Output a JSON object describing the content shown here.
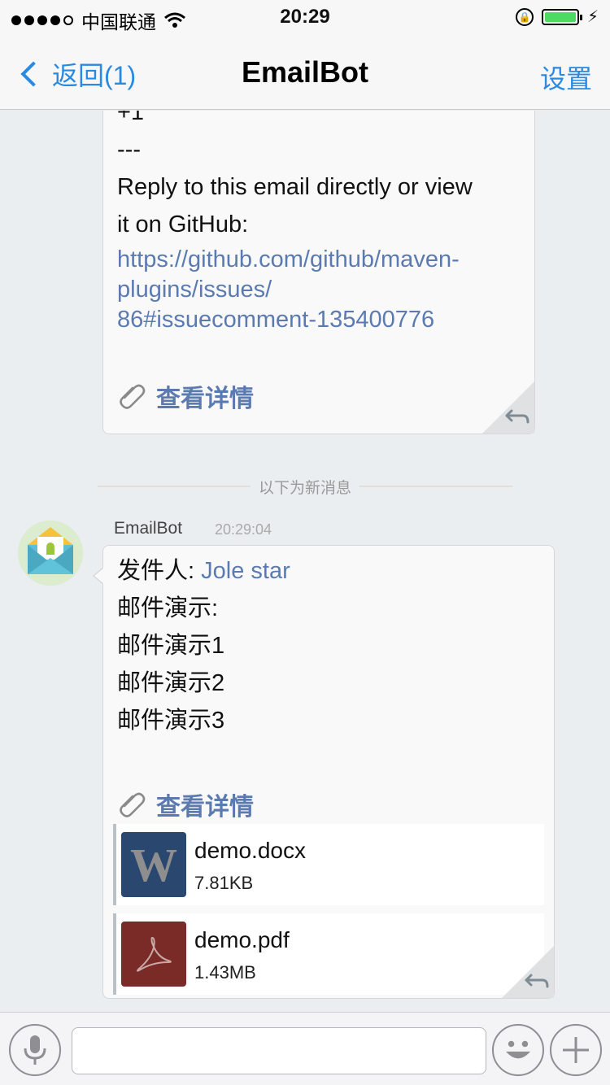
{
  "status_bar": {
    "carrier": "中国联通",
    "time": "20:29"
  },
  "nav": {
    "back_label": "返回(1)",
    "title": "EmailBot",
    "settings_label": "设置"
  },
  "previous_message": {
    "lines": [
      "+1",
      "---",
      "Reply to this email directly or view",
      "it on GitHub:"
    ],
    "link_lines": [
      "https://github.com/github/maven-",
      "plugins/issues/",
      "86#issuecomment-135400776"
    ],
    "detail_label": "查看详情"
  },
  "divider_text": "以下为新消息",
  "new_message": {
    "sender_name": "EmailBot",
    "time": "20:29:04",
    "from_label": "发件人: ",
    "from_name": "Jole star",
    "lines": [
      "邮件演示:",
      "邮件演示1",
      "邮件演示2",
      "邮件演示3"
    ],
    "detail_label": "查看详情",
    "attachments": [
      {
        "name": "demo.docx",
        "size": "7.81KB",
        "type_icon": "word-doc-icon",
        "icon_letter": "W"
      },
      {
        "name": "demo.pdf",
        "size": "1.43MB",
        "type_icon": "pdf-icon"
      }
    ]
  },
  "input_bar": {
    "text_value": ""
  },
  "colors": {
    "accent": "#2a8ae0",
    "link": "#5b7bb0",
    "background": "#ebeef0",
    "battery": "#4cd964"
  }
}
